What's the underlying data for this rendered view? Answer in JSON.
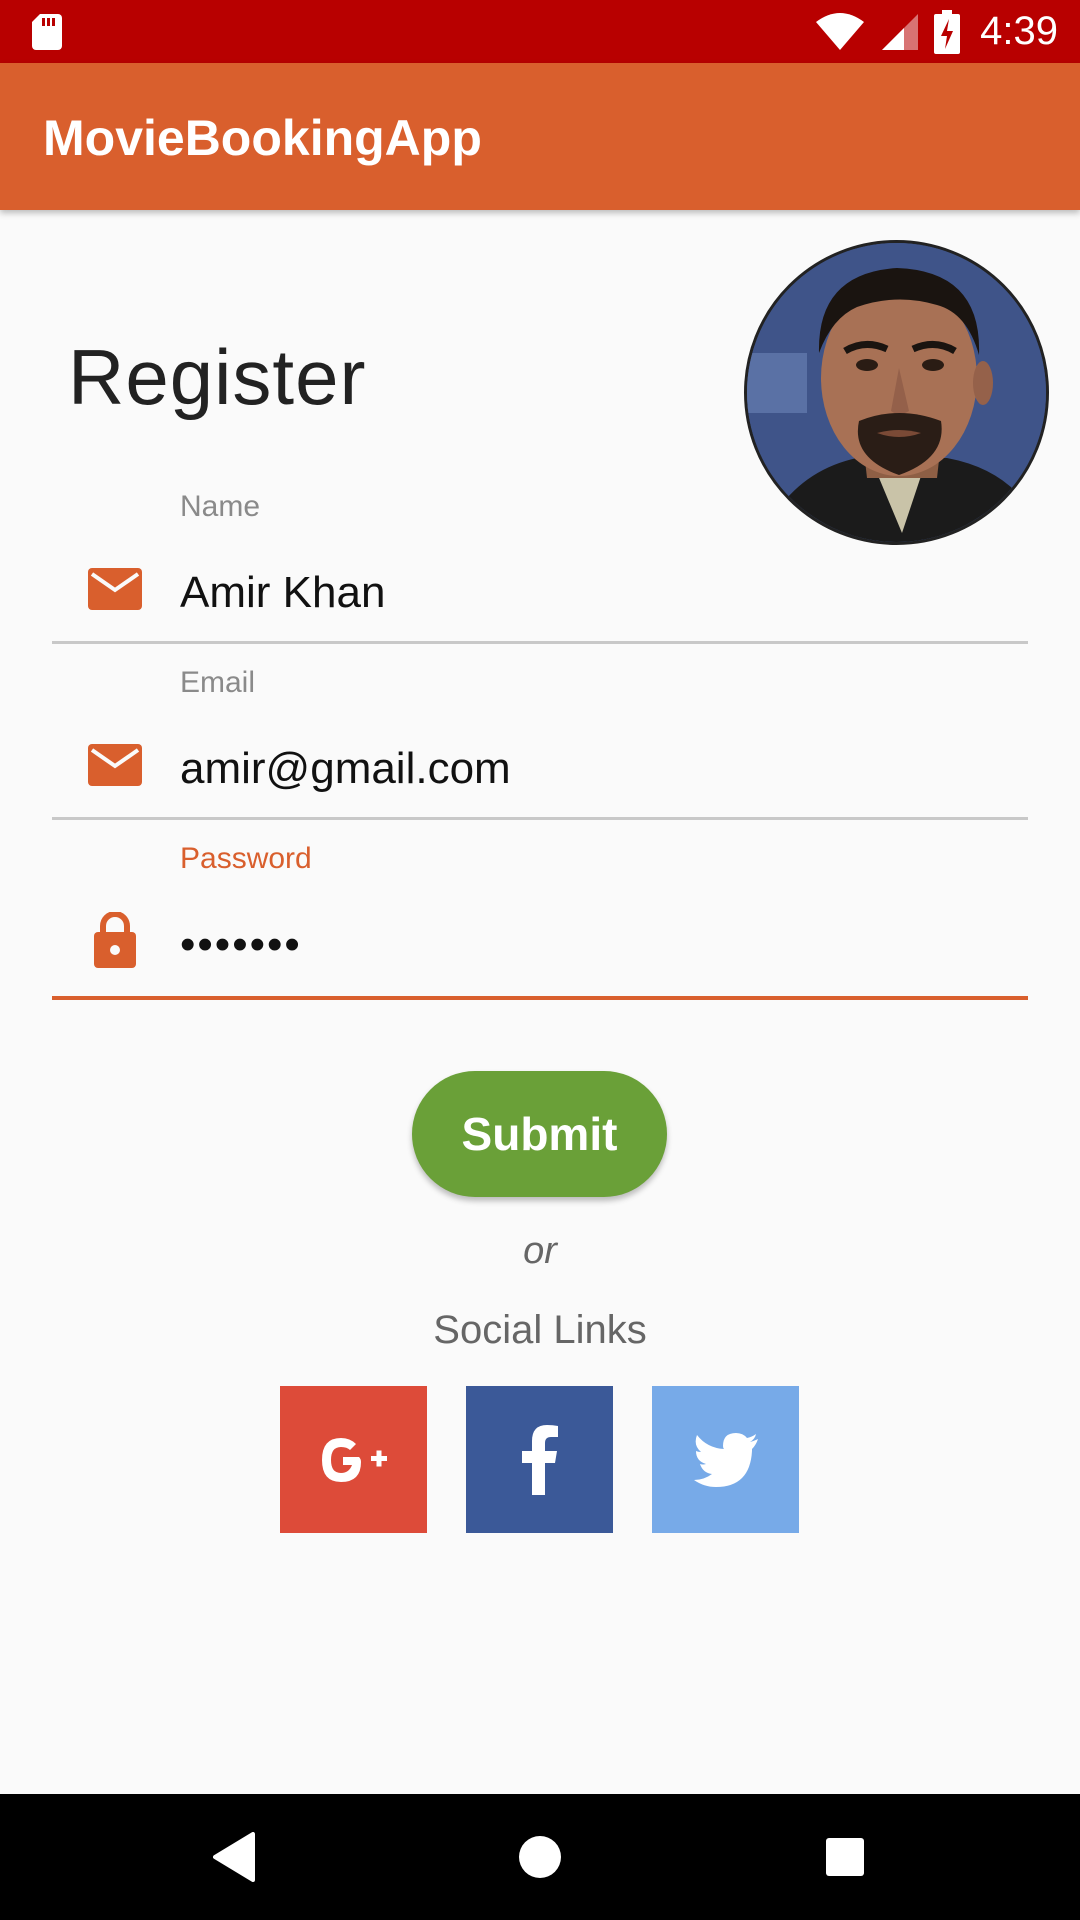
{
  "status_bar": {
    "time": "4:39",
    "icons": [
      "sd-card-icon",
      "wifi-icon",
      "signal-icon",
      "battery-charging-icon"
    ]
  },
  "app_bar": {
    "title": "MovieBookingApp"
  },
  "form": {
    "title": "Register",
    "avatar": "profile-photo",
    "fields": [
      {
        "label": "Name",
        "value": "Amir Khan",
        "icon": "mail-icon"
      },
      {
        "label": "Email",
        "value": "amir@gmail.com",
        "icon": "mail-icon"
      },
      {
        "label": "Password",
        "value": "•••••••",
        "icon": "lock-icon",
        "active": true
      }
    ],
    "submit_label": "Submit",
    "or_text": "or",
    "social_title": "Social Links",
    "social": [
      {
        "name": "google-plus",
        "color": "#dd4b39"
      },
      {
        "name": "facebook",
        "color": "#3b5998"
      },
      {
        "name": "twitter",
        "color": "#77aae8"
      }
    ]
  },
  "colors": {
    "status_bar": "#b80000",
    "app_bar": "#d95f2d",
    "accent": "#d95f2d",
    "submit": "#6aa038"
  },
  "nav_bar": {
    "buttons": [
      "back-icon",
      "home-icon",
      "recents-icon"
    ]
  }
}
